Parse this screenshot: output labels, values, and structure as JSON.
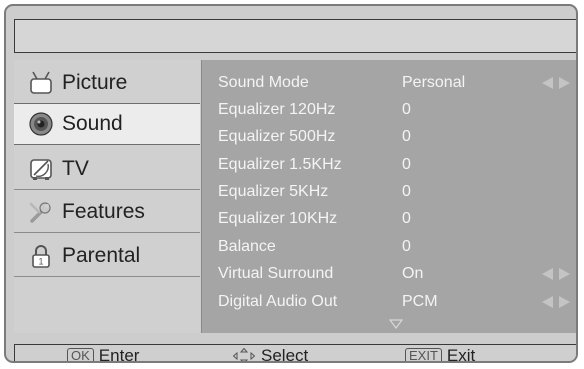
{
  "sidebar": {
    "items": [
      {
        "label": "Picture",
        "icon": "tv-icon",
        "active": false
      },
      {
        "label": "Sound",
        "icon": "speaker-icon",
        "active": true
      },
      {
        "label": "TV",
        "icon": "satellite-dish-icon",
        "active": false
      },
      {
        "label": "Features",
        "icon": "wrench-icon",
        "active": false
      },
      {
        "label": "Parental",
        "icon": "lock-icon",
        "active": false
      }
    ]
  },
  "settings": {
    "rows": [
      {
        "label": "Sound Mode",
        "value": "Personal",
        "arrows": true
      },
      {
        "label": "Equalizer 120Hz",
        "value": "0",
        "arrows": false
      },
      {
        "label": "Equalizer 500Hz",
        "value": "0",
        "arrows": false
      },
      {
        "label": "Equalizer 1.5KHz",
        "value": "0",
        "arrows": false
      },
      {
        "label": "Equalizer 5KHz",
        "value": "0",
        "arrows": false
      },
      {
        "label": "Equalizer 10KHz",
        "value": "0",
        "arrows": false
      },
      {
        "label": "Balance",
        "value": "0",
        "arrows": false
      },
      {
        "label": "Virtual Surround",
        "value": "On",
        "arrows": true
      },
      {
        "label": "Digital Audio Out",
        "value": "PCM",
        "arrows": true
      }
    ]
  },
  "footer": {
    "enter_key": "OK",
    "enter_label": "Enter",
    "select_label": "Select",
    "exit_key": "EXIT",
    "exit_label": "Exit"
  },
  "colors": {
    "panel": "#a5a5a5",
    "sidebar": "#d0d0d0",
    "active_item": "#ececec",
    "text_light": "#f4f4f4",
    "arrow_glyph": "#c4c4c4"
  }
}
